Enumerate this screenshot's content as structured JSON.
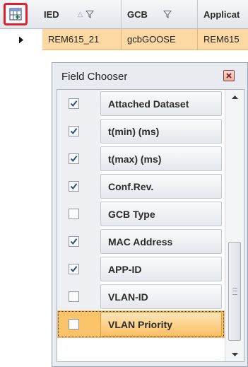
{
  "grid": {
    "columns": [
      {
        "label": "IED",
        "sort_indicator": "△",
        "filter_icon": "filter-icon"
      },
      {
        "label": "GCB",
        "filter_icon": "filter-icon"
      },
      {
        "label": "Applicat"
      }
    ],
    "row": {
      "indicator_icon": "row-pointer-icon",
      "cells": [
        "REM615_21",
        "gcbGOOSE",
        "REM615"
      ]
    },
    "highlight_color": "#fcd9a2"
  },
  "field_chooser": {
    "title": "Field Chooser",
    "close_icon": "close-icon",
    "fields": [
      {
        "label": "Attached Dataset",
        "checked": true
      },
      {
        "label": "t(min) (ms)",
        "checked": true
      },
      {
        "label": "t(max) (ms)",
        "checked": true
      },
      {
        "label": "Conf.Rev.",
        "checked": true
      },
      {
        "label": "GCB Type",
        "checked": false
      },
      {
        "label": "MAC Address",
        "checked": true
      },
      {
        "label": "APP-ID",
        "checked": true
      },
      {
        "label": "VLAN-ID",
        "checked": false
      },
      {
        "label": "VLAN Priority",
        "checked": false,
        "selected": true
      }
    ],
    "selected_color": "#fcc46a",
    "scroll_up_icon": "scroll-up-icon",
    "scroll_down_icon": "scroll-down-icon"
  }
}
